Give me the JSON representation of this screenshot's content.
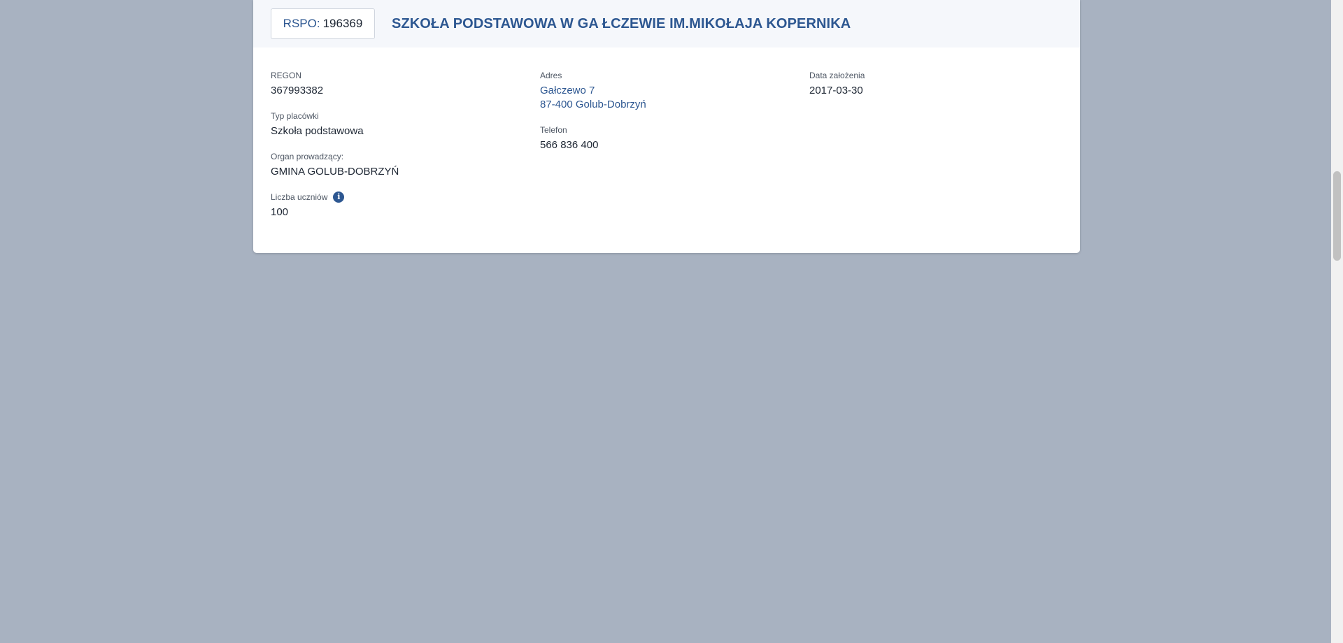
{
  "school": {
    "rspo_label": "RSPO:",
    "rspo_value": "196369",
    "name": "SZKOŁA PODSTAWOWA W GA ŁCZEWIE IM.MIKOŁAJA KOPERNIKA"
  },
  "fields": {
    "regon_label": "REGON",
    "regon_value": "367993382",
    "type_label": "Typ placówki",
    "type_value": "Szkoła podstawowa",
    "organ_label": "Organ prowadzący:",
    "organ_value": "GMINA GOLUB-DOBRZYŃ",
    "students_label": "Liczba uczniów",
    "students_value": "100",
    "address_label": "Adres",
    "address_line1": "Gałczewo 7",
    "address_line2": "87-400 Golub-Dobrzyń",
    "phone_label": "Telefon",
    "phone_value": "566 836 400",
    "founded_label": "Data założenia",
    "founded_value": "2017-03-30"
  },
  "icons": {
    "info": "info-icon",
    "info_glyph": "i"
  },
  "colors": {
    "accent": "#2d5791",
    "background": "#a8b2c1",
    "card": "#ffffff",
    "header": "#f5f7fb"
  }
}
